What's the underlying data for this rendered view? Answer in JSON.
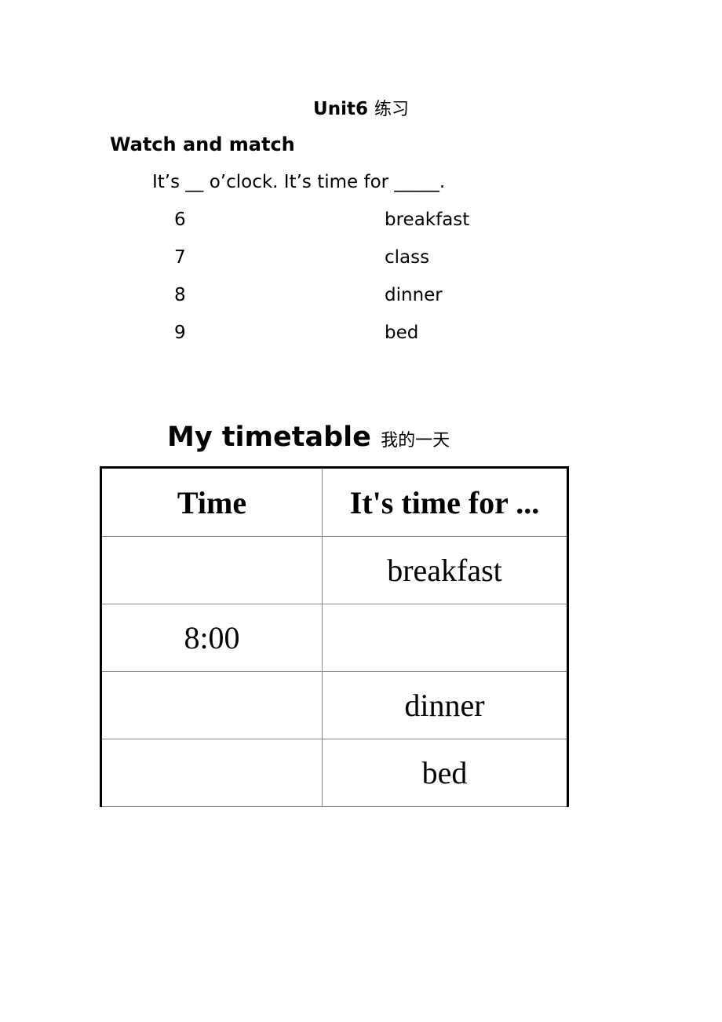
{
  "header": {
    "title": "Unit6",
    "title_cn": "练习"
  },
  "match_section": {
    "heading": "Watch and match",
    "pattern": "It’s __ o’clock.  It’s time for _____.",
    "numbers": [
      "6",
      "7",
      "8",
      "9"
    ],
    "activities": [
      "breakfast",
      "class",
      "dinner",
      "bed"
    ]
  },
  "timetable": {
    "title": "My timetable",
    "title_cn": "我的一天",
    "columns": [
      "Time",
      "It's time for ..."
    ],
    "rows": [
      {
        "time": "",
        "activity": "breakfast"
      },
      {
        "time": "8:00",
        "activity": ""
      },
      {
        "time": "",
        "activity": "dinner"
      },
      {
        "time": "",
        "activity": "bed"
      }
    ]
  }
}
